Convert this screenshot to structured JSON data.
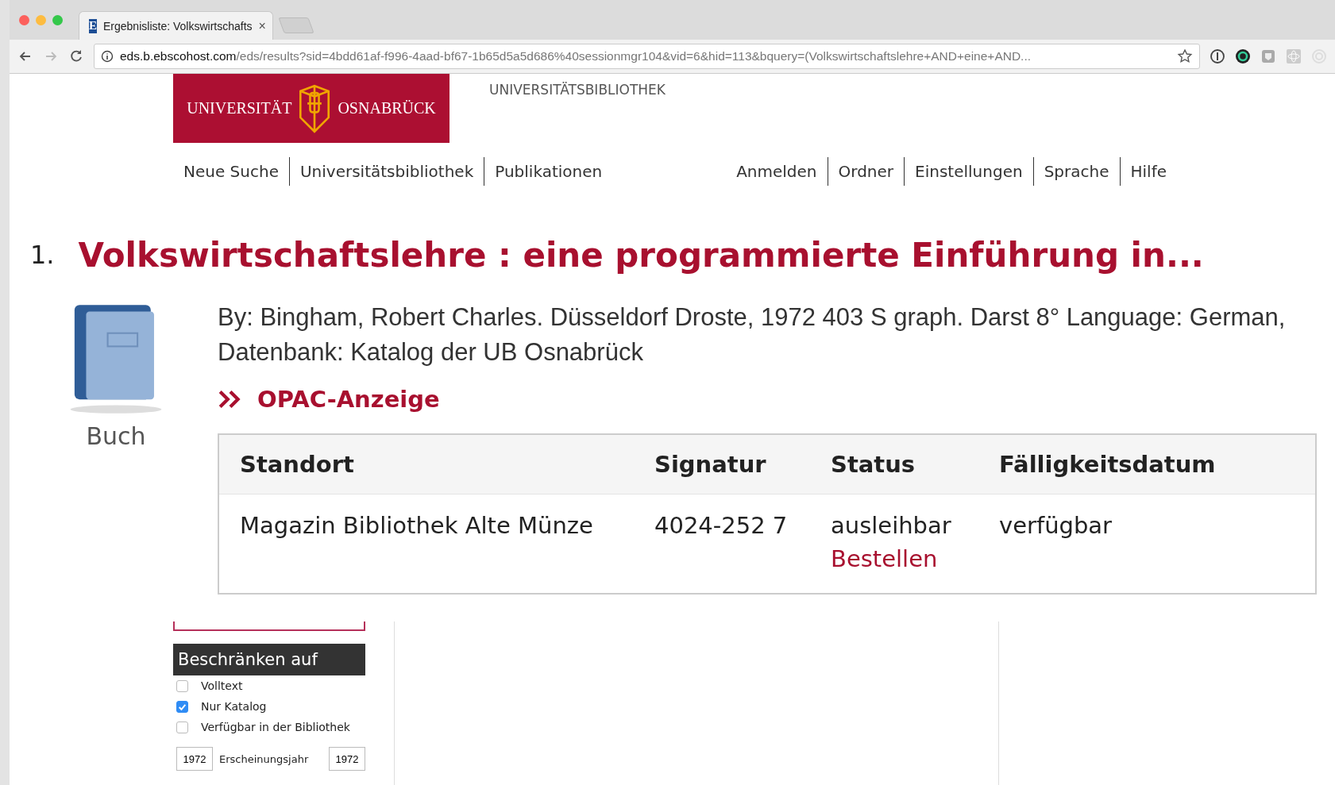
{
  "browser": {
    "tabs": [
      {
        "favicon_letter": "E",
        "title": "Ergebnisliste: Volkswirtschafts",
        "close": "×",
        "selected": true
      }
    ],
    "url_host": "eds.b.ebscohost.com",
    "url_path": "/eds/results?sid=4bdd61af-f996-4aad-bf67-1b65d5a5d686%40sessionmgr104&vid=6&hid=113&bquery=(Volkswirtschaftslehre+AND+eine+AND..."
  },
  "header": {
    "logo_left": "UNIVERSITÄT",
    "logo_right": "OSNABRÜCK",
    "site_label": "UNIVERSITÄTSBIBLIOTHEK"
  },
  "nav_left": [
    "Neue Suche",
    "Universitätsbibliothek",
    "Publikationen"
  ],
  "nav_right": [
    "Anmelden",
    "Ordner",
    "Einstellungen",
    "Sprache",
    "Hilfe"
  ],
  "result": {
    "number": "1.",
    "title": "Volkswirtschaftslehre : eine programmierte Einführung in...",
    "type_label": "Buch",
    "details": "By: Bingham, Robert Charles. Düsseldorf Droste, 1972 403 S graph. Darst 8° Language: German, Datenbank: Katalog der UB Osnabrück",
    "opac_link": "OPAC-Anzeige",
    "holdings": {
      "columns": [
        "Standort",
        "Signatur",
        "Status",
        "Fälligkeitsdatum"
      ],
      "rows": [
        {
          "standort": "Magazin Bibliothek Alte Münze",
          "signatur": "4024-252 7",
          "status": "ausleihbar",
          "action": "Bestellen",
          "due": "verfügbar"
        }
      ]
    }
  },
  "sidebar": {
    "heading": "Beschränken auf",
    "filters": [
      {
        "label": "Volltext",
        "checked": false
      },
      {
        "label": "Nur Katalog",
        "checked": true
      },
      {
        "label": "Verfügbar in der Bibliothek",
        "checked": false
      }
    ],
    "year": {
      "from": "1972",
      "label": "Erscheinungsjahr",
      "to": "1972"
    }
  }
}
